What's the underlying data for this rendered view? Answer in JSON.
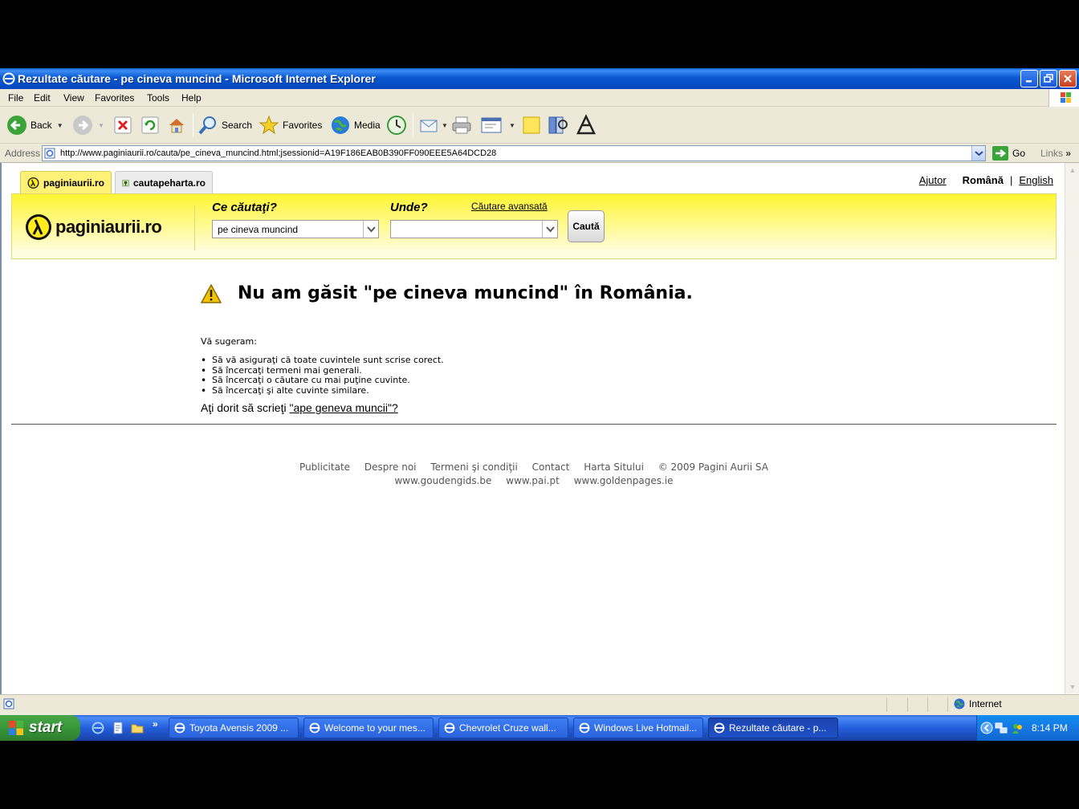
{
  "window": {
    "title": "Rezultate căutare - pe cineva muncind - Microsoft Internet Explorer"
  },
  "menu": [
    "File",
    "Edit",
    "View",
    "Favorites",
    "Tools",
    "Help"
  ],
  "toolbar": {
    "back_label": "Back",
    "search_label": "Search",
    "favorites_label": "Favorites",
    "media_label": "Media"
  },
  "address": {
    "label": "Address",
    "url": "http://www.paginiaurii.ro/cauta/pe_cineva_muncind.html;jsessionid=A19F186EAB0B390FF090EEE5A64DCD28",
    "go_label": "Go",
    "links_label": "Links"
  },
  "site": {
    "tabs": [
      "paginiaurii.ro",
      "cautapeharta.ro"
    ],
    "help_link": "Ajutor",
    "lang_active": "Română",
    "lang_sep": "|",
    "lang_link": "English",
    "logo_text": "paginiaurii.ro",
    "what_label": "Ce căutaţi?",
    "where_label": "Unde?",
    "advanced_link": "Căutare avansată",
    "what_value": "pe cineva muncind",
    "where_value": "",
    "search_button": "Caută",
    "no_results": "Nu am găsit \"pe cineva muncind\" în România.",
    "suggest_intro": "Vă sugeram:",
    "suggestions": [
      "Să vă asiguraţi că toate cuvintele sunt scrise corect.",
      "Să încercaţi termeni mai generali.",
      "Să încercaţi o căutare cu mai puţine cuvinte.",
      "Să încercaţi şi alte cuvinte similare."
    ],
    "did_you_mean_prefix": "Aţi dorit să scrieţi ",
    "did_you_mean_link": "\"ape geneva muncii\"?",
    "footer_row1": [
      "Publicitate",
      "Despre noi",
      "Termeni şi condiţii",
      "Contact",
      "Harta Sitului",
      "© 2009 Pagini Aurii SA"
    ],
    "footer_row2": [
      "www.goudengids.be",
      "www.pai.pt",
      "www.goldenpages.ie"
    ]
  },
  "status": {
    "zone_label": "Internet"
  },
  "taskbar": {
    "start_label": "start",
    "tasks": [
      "Toyota Avensis 2009 ...",
      "Welcome to your mes...",
      "Chevrolet Cruze wall...",
      "Windows Live Hotmail...",
      "Rezultate căutare - p..."
    ],
    "clock": "8:14 PM"
  },
  "colors": {
    "xp_blue": "#0a58d0",
    "site_yellow": "#fff533",
    "warning_yellow": "#f5c400"
  }
}
